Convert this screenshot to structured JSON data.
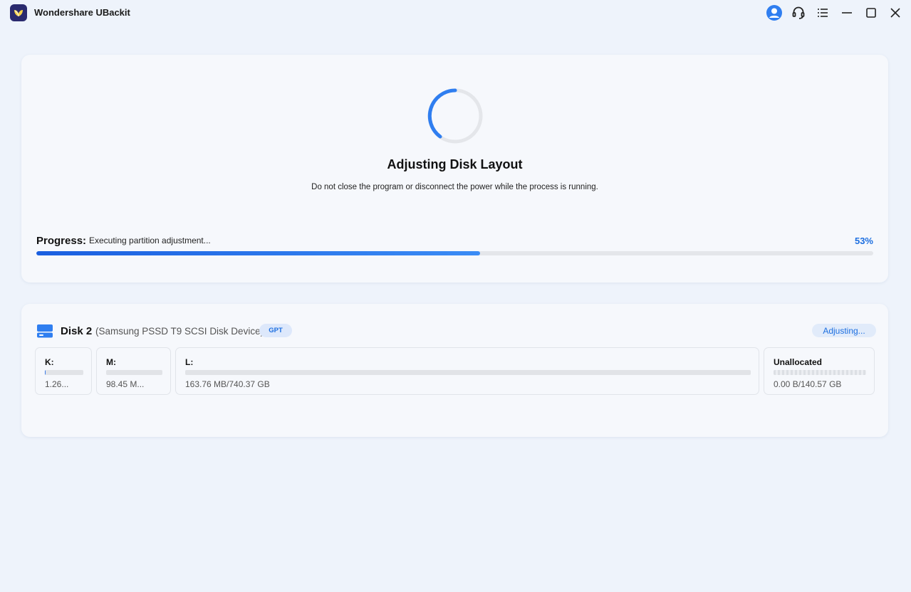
{
  "app": {
    "title": "Wondershare UBackit"
  },
  "window_controls": [
    {
      "name": "account-icon"
    },
    {
      "name": "support-headset-icon"
    },
    {
      "name": "menu-icon"
    },
    {
      "name": "minimize-icon"
    },
    {
      "name": "maximize-icon"
    },
    {
      "name": "close-icon"
    }
  ],
  "status": {
    "title": "Adjusting Disk Layout",
    "subtitle": "Do not close the program or disconnect the power while the process is running.",
    "progress_label": "Progress:",
    "progress_status": "Executing partition adjustment...",
    "progress_percent_text": "53%",
    "progress_value": 0.53
  },
  "disk": {
    "name": "Disk 2",
    "model": "(Samsung PSSD T9 SCSI Disk Device)",
    "partition_style": "GPT",
    "state": "Adjusting...",
    "partitions": [
      {
        "label": "K:",
        "size": "1.26...",
        "used_fraction": 0.01
      },
      {
        "label": "M:",
        "size": "98.45 M...",
        "used_fraction": 0.0
      },
      {
        "label": "L:",
        "size": "163.76 MB/740.37 GB",
        "used_fraction": 0.0
      },
      {
        "label": "Unallocated",
        "size": "0.00 B/140.57 GB",
        "used_fraction": 0.0
      }
    ]
  },
  "colors": {
    "accent": "#1d6fe0",
    "background": "#eef3fb",
    "card": "#f6f8fc"
  }
}
